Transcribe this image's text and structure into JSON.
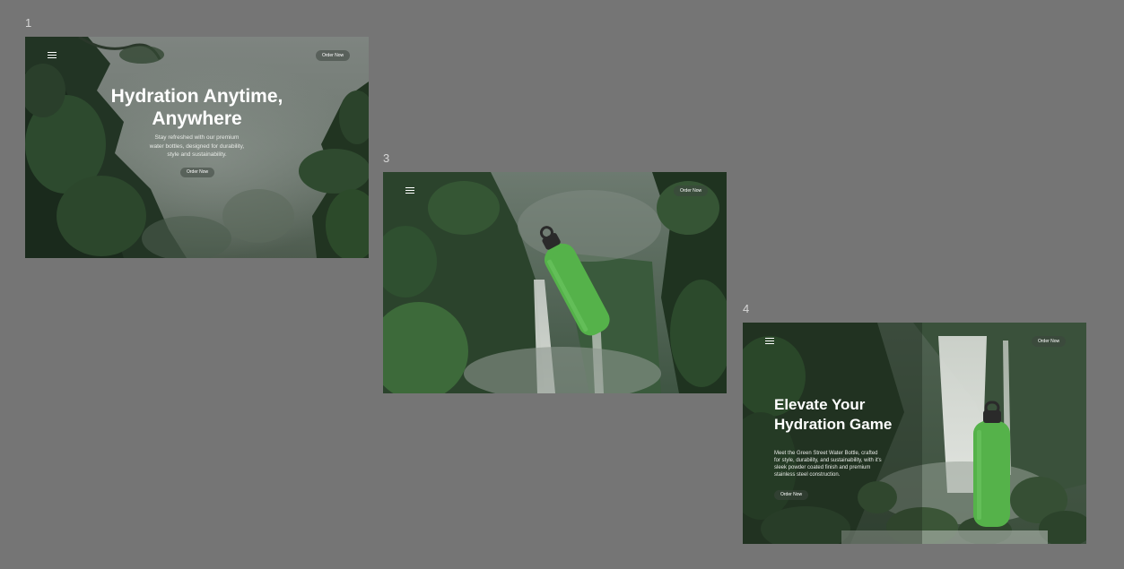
{
  "frames": [
    {
      "number": "1",
      "menu_icon": "hamburger-icon",
      "order_button": "Order Now",
      "title_line1": "Hydration Anytime,",
      "title_line2": "Anywhere",
      "description_lines": [
        "Stay refreshed with our premium",
        "water bottles, designed for durability,",
        "style and sustainability."
      ],
      "cta_button": "Order Now"
    },
    {
      "number": "3",
      "menu_icon": "hamburger-icon",
      "order_button": "Order Now"
    },
    {
      "number": "4",
      "menu_icon": "hamburger-icon",
      "order_button": "Order Now",
      "title_line1": "Elevate Your",
      "title_line2": "Hydration Game",
      "description_lines": [
        "Meet the Green Street Water Bottle, crafted",
        "for style, durability, and sustainability, with it's",
        "sleek powder coated finish and premium",
        "stainless steel construction."
      ],
      "cta_button": "Order Now"
    }
  ],
  "colors": {
    "canvas": "#757575",
    "bottle": "#55b24a",
    "cap": "#2a2a2a"
  }
}
